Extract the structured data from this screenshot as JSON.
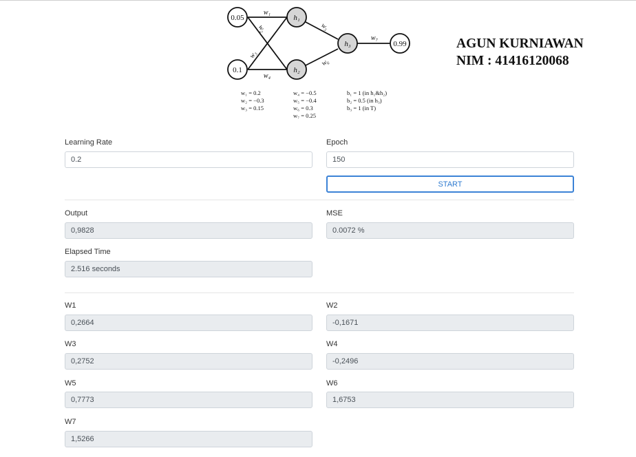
{
  "diagram": {
    "nodes": {
      "x1": "0.05",
      "x2": "0.1",
      "h1": "h₁",
      "h2": "h₂",
      "h3": "h₃",
      "target": "0.99"
    },
    "edges": {
      "w1": "w₁",
      "w2": "w₂",
      "w3": "w₃",
      "w4": "w₄",
      "w5": "w₅",
      "w6": "w₆",
      "w7": "w₇"
    },
    "weights_col1": [
      "w₁ = 0.2",
      "w₂ = −0.3",
      "w₃ = 0.15"
    ],
    "weights_col2": [
      "w₄ = −0.5",
      "w₅ = −0.4",
      "w₆ = 0.3",
      "w₇ = 0.25"
    ],
    "bias_col": [
      "b₁ = 1 (in h₁&h₂)",
      "b₂ = 0.5 (in h₃)",
      "b₃ = 1 (in T)"
    ]
  },
  "author": {
    "name": "AGUN KURNIAWAN",
    "nim": "NIM : 41416120068"
  },
  "form": {
    "learning_rate": {
      "label": "Learning Rate",
      "value": "0.2"
    },
    "epoch": {
      "label": "Epoch",
      "value": "150"
    },
    "start_label": "START"
  },
  "results": {
    "output": {
      "label": "Output",
      "value": "0,9828"
    },
    "mse": {
      "label": "MSE",
      "value": "0.0072 %"
    },
    "elapsed": {
      "label": "Elapsed Time",
      "value": "2.516 seconds"
    }
  },
  "weights": [
    {
      "label": "W1",
      "value": "0,2664"
    },
    {
      "label": "W2",
      "value": "-0,1671"
    },
    {
      "label": "W3",
      "value": "0,2752"
    },
    {
      "label": "W4",
      "value": "-0,2496"
    },
    {
      "label": "W5",
      "value": "0,7773"
    },
    {
      "label": "W6",
      "value": "1,6753"
    },
    {
      "label": "W7",
      "value": "1,5266"
    }
  ],
  "colors": {
    "node_fill_hidden": "#d6d6d6",
    "button_border": "#3b82d6",
    "readonly_bg": "#e9ecef"
  }
}
